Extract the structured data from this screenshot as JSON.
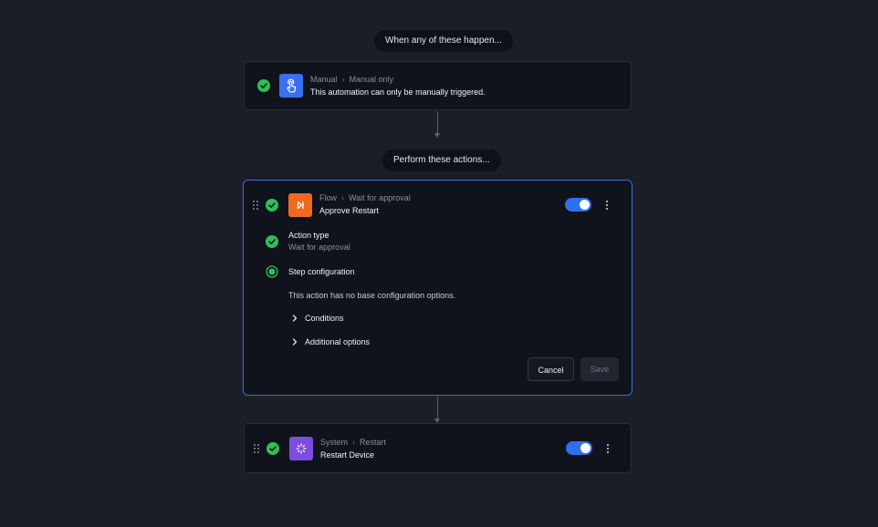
{
  "trigger_section": {
    "label": "When any of these happen...",
    "card": {
      "crumb_parent": "Manual",
      "crumb_child": "Manual only",
      "description": "This automation can only be manually triggered.",
      "icon": "hand-pointer-icon",
      "icon_color": "#3a6ff0"
    }
  },
  "actions_section": {
    "label": "Perform these actions...",
    "action1": {
      "crumb_parent": "Flow",
      "crumb_child": "Wait for approval",
      "title": "Approve Restart",
      "icon": "skip-forward-icon",
      "icon_color": "#ee6a1f",
      "enabled": true,
      "action_type_label": "Action type",
      "action_type_value": "Wait for approval",
      "step_config_label": "Step configuration",
      "no_options_text": "This action has no base configuration options.",
      "conditions_label": "Conditions",
      "additional_options_label": "Additional options",
      "cancel_label": "Cancel",
      "save_label": "Save"
    },
    "action2": {
      "crumb_parent": "System",
      "crumb_child": "Restart",
      "title": "Restart Device",
      "icon": "loading-spinner-icon",
      "icon_color": "#7c4ddf",
      "enabled": true
    }
  },
  "colors": {
    "background": "#1b1e27",
    "card": "#10131b",
    "accent": "#2f6fed",
    "success": "#2fbe5a"
  }
}
